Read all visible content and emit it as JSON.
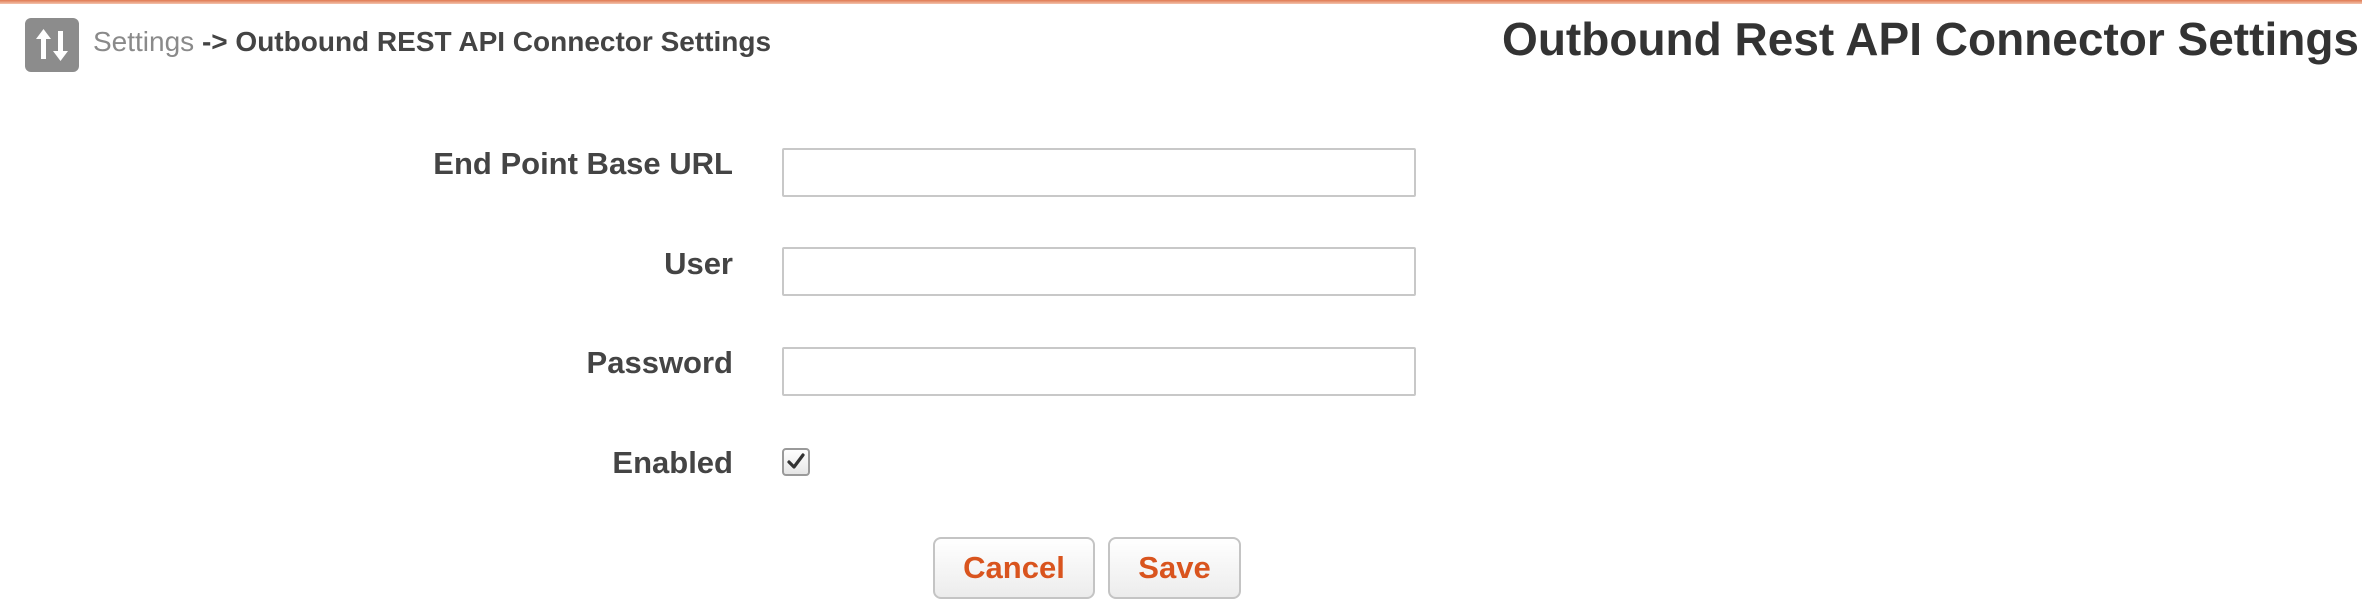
{
  "header": {
    "app_icon": "sort-arrows-icon",
    "breadcrumb": {
      "parent": "Settings",
      "separator": "->",
      "current": "Outbound REST API Connector Settings"
    },
    "page_title": "Outbound Rest API Connector Settings"
  },
  "form": {
    "endpoint": {
      "label": "End Point Base URL",
      "value": "",
      "placeholder": ""
    },
    "user": {
      "label": "User",
      "value": "",
      "placeholder": ""
    },
    "password": {
      "label": "Password",
      "value": "",
      "placeholder": ""
    },
    "enabled": {
      "label": "Enabled",
      "checked": true,
      "icon": "checkmark-icon"
    }
  },
  "actions": {
    "cancel_label": "Cancel",
    "save_label": "Save"
  },
  "colors": {
    "accent": "#d9541e",
    "top_bar": "#e07a52",
    "icon_bg": "#8c8c8c",
    "text": "#444444"
  }
}
